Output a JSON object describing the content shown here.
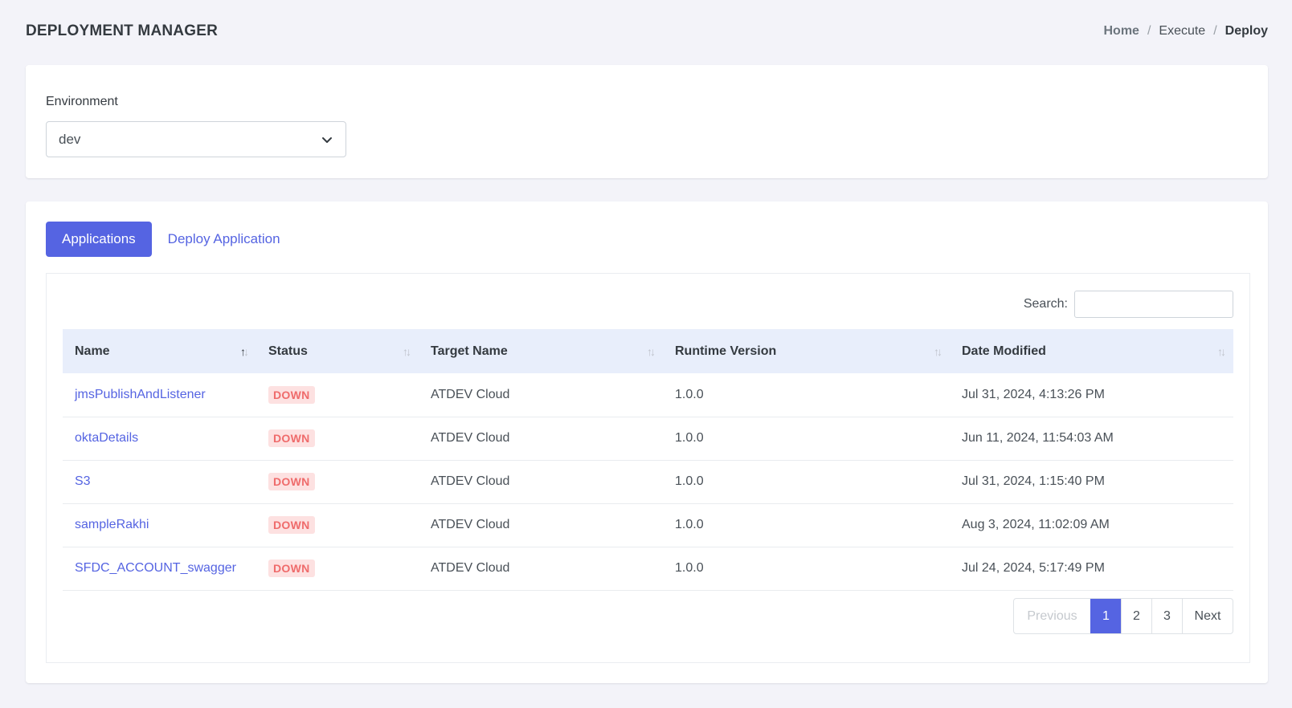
{
  "header": {
    "title": "DEPLOYMENT MANAGER",
    "breadcrumb": [
      "Home",
      "Execute",
      "Deploy"
    ],
    "separator": "/"
  },
  "environment": {
    "label": "Environment",
    "selected": "dev"
  },
  "tabs": {
    "active": "Applications",
    "other": "Deploy Application"
  },
  "search": {
    "label": "Search:",
    "value": ""
  },
  "table": {
    "columns": [
      "Name",
      "Status",
      "Target Name",
      "Runtime Version",
      "Date Modified"
    ],
    "sorted_column": "Name",
    "rows": [
      {
        "name": "jmsPublishAndListener",
        "status": "DOWN",
        "target": "ATDEV Cloud",
        "runtime": "1.0.0",
        "modified": "Jul 31, 2024, 4:13:26 PM"
      },
      {
        "name": "oktaDetails",
        "status": "DOWN",
        "target": "ATDEV Cloud",
        "runtime": "1.0.0",
        "modified": "Jun 11, 2024, 11:54:03 AM"
      },
      {
        "name": "S3",
        "status": "DOWN",
        "target": "ATDEV Cloud",
        "runtime": "1.0.0",
        "modified": "Jul 31, 2024, 1:15:40 PM"
      },
      {
        "name": "sampleRakhi",
        "status": "DOWN",
        "target": "ATDEV Cloud",
        "runtime": "1.0.0",
        "modified": "Aug 3, 2024, 11:02:09 AM"
      },
      {
        "name": "SFDC_ACCOUNT_swagger",
        "status": "DOWN",
        "target": "ATDEV Cloud",
        "runtime": "1.0.0",
        "modified": "Jul 24, 2024, 5:17:49 PM"
      }
    ]
  },
  "pagination": {
    "previous": "Previous",
    "pages": [
      "1",
      "2",
      "3"
    ],
    "current": "1",
    "next": "Next"
  },
  "colors": {
    "accent": "#5564e2",
    "status_down_bg": "#fde1e1",
    "status_down_text": "#ef6b6b",
    "table_header_bg": "#e8eefb"
  },
  "icons": {
    "select": "chevron-down-icon",
    "sort": "sort-arrows-icon"
  }
}
